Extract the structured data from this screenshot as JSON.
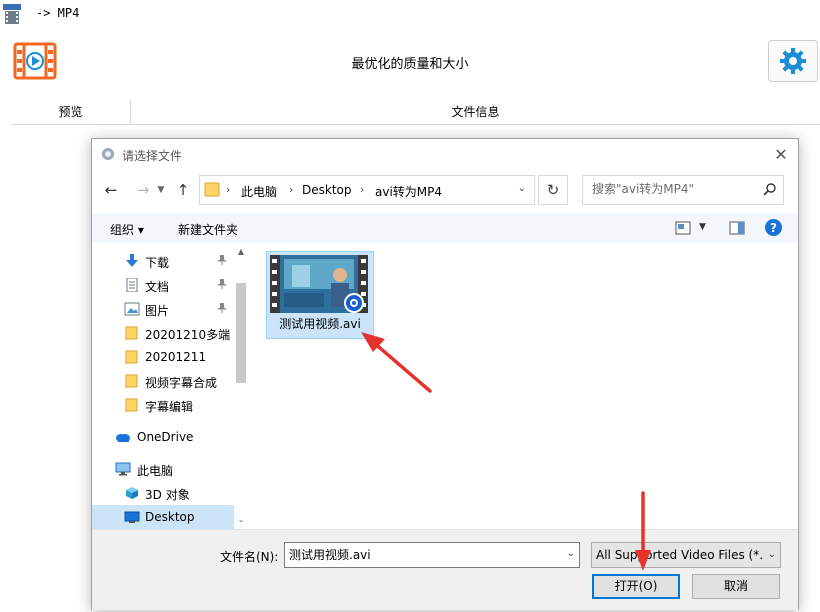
{
  "app": {
    "title": "-> MP4",
    "header_title": "最优化的质量和大小",
    "columns": [
      "预览",
      "文件信息"
    ],
    "icons": {
      "app": "app-film-icon",
      "logo": "video-logo-icon",
      "settings": "gear-icon"
    },
    "accent_color": "#f26722",
    "gear_color": "#1a8fd9"
  },
  "dialog": {
    "title": "请选择文件",
    "address": {
      "segments": [
        "此电脑",
        "Desktop",
        "avi转为MP4"
      ]
    },
    "search": {
      "placeholder": "搜索\"avi转为MP4\""
    },
    "toolbar": {
      "organize": "组织 ▾",
      "new_folder": "新建文件夹"
    },
    "nav_items": [
      {
        "label": "下载",
        "icon": "download-arrow-icon",
        "pinned": true
      },
      {
        "label": "文档",
        "icon": "document-icon",
        "pinned": true
      },
      {
        "label": "图片",
        "icon": "picture-icon",
        "pinned": true
      },
      {
        "label": "20201210多端",
        "icon": "folder-icon",
        "pinned": false
      },
      {
        "label": "20201211",
        "icon": "folder-icon",
        "pinned": false
      },
      {
        "label": "视频字幕合成",
        "icon": "folder-icon",
        "pinned": false
      },
      {
        "label": "字幕编辑",
        "icon": "folder-icon",
        "pinned": false
      },
      {
        "label": "OneDrive",
        "icon": "cloud-icon",
        "pinned": false
      },
      {
        "label": "此电脑",
        "icon": "monitor-icon",
        "pinned": false
      },
      {
        "label": "3D 对象",
        "icon": "cube-3d-icon",
        "pinned": false
      },
      {
        "label": "Desktop",
        "icon": "desktop-icon",
        "pinned": false,
        "selected": true
      }
    ],
    "files": [
      {
        "name": "测试用视频.avi",
        "icon": "video-thumbnail-icon"
      }
    ],
    "filename_label": "文件名(N):",
    "filename_value": "测试用视频.avi",
    "filetype": "All Supported Video Files (*.",
    "open_button": "打开(O)",
    "cancel_button": "取消",
    "selection_color": "#cce4f7"
  },
  "annotations": {
    "arrow_color": "#e5322d"
  }
}
